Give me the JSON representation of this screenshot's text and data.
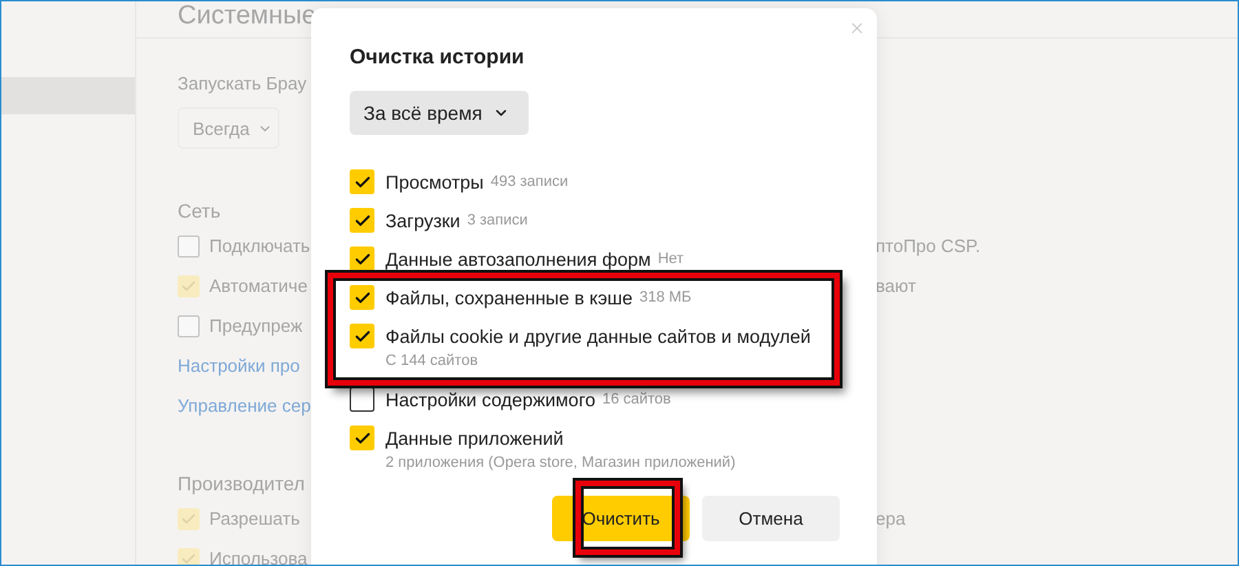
{
  "sidebar": {
    "items": [
      {
        "selected": true
      }
    ]
  },
  "settings": {
    "title": "Системные",
    "startup_label": "Запускать Брау",
    "startup_select": "Всегда",
    "sections": [
      {
        "title": "Сеть",
        "rows": [
          {
            "kind": "checkbox",
            "checked": false,
            "label": "Подключать",
            "right_text": "птоПро CSP."
          },
          {
            "kind": "checkbox",
            "checked": true,
            "label": "Автоматиче",
            "right_text": "вают"
          },
          {
            "kind": "checkbox",
            "checked": false,
            "label": "Предупреж"
          },
          {
            "kind": "link",
            "label": "Настройки про"
          },
          {
            "kind": "link",
            "label": "Управление сер"
          }
        ]
      },
      {
        "title": "Производител",
        "rows": [
          {
            "kind": "checkbox",
            "checked": true,
            "label": "Разрешать",
            "right_text": "ера"
          },
          {
            "kind": "checkbox",
            "checked": true,
            "label": "Использова"
          }
        ]
      }
    ]
  },
  "dialog": {
    "title": "Очистка истории",
    "period": "За всё время",
    "items": [
      {
        "label": "Просмотры",
        "count": "493 записи",
        "checked": true,
        "highlighted": false
      },
      {
        "label": "Загрузки",
        "count": "3 записи",
        "checked": true,
        "highlighted": false
      },
      {
        "label": "Данные автозаполнения форм",
        "count": "Нет",
        "checked": true,
        "highlighted": false
      },
      {
        "label": "Файлы, сохраненные в кэше",
        "count": "318 МБ",
        "checked": true,
        "highlighted": true
      },
      {
        "label": "Файлы cookie и другие данные сайтов и модулей",
        "detail": "С 144 сайтов",
        "checked": true,
        "highlighted": true
      },
      {
        "label": "Настройки содержимого",
        "count": "16 сайтов",
        "checked": false,
        "highlighted": false
      },
      {
        "label": "Данные приложений",
        "detail": "2 приложения (Opera store, Магазин приложений)",
        "checked": true,
        "highlighted": false
      }
    ],
    "buttons": [
      {
        "label": "Очистить",
        "kind": "primary",
        "highlighted": true
      },
      {
        "label": "Отмена",
        "kind": "secondary",
        "highlighted": false
      }
    ]
  }
}
